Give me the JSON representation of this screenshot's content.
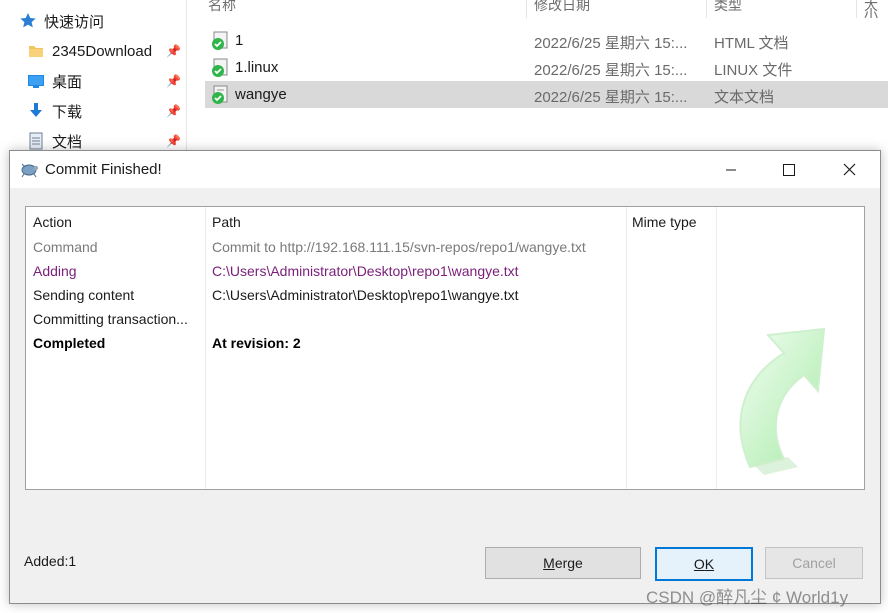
{
  "sidebar": {
    "items": [
      {
        "label": "快速访问",
        "icon": "star-icon",
        "pinned": false
      },
      {
        "label": "2345Download",
        "icon": "folder-icon",
        "pinned": true
      },
      {
        "label": "桌面",
        "icon": "desktop-icon",
        "pinned": true
      },
      {
        "label": "下载",
        "icon": "download-icon",
        "pinned": true
      },
      {
        "label": "文档",
        "icon": "document-icon",
        "pinned": true
      }
    ]
  },
  "file_list": {
    "columns": [
      "名称",
      "修改日期",
      "类型",
      "大小"
    ],
    "rows": [
      {
        "name": "1",
        "date": "2022/6/25 星期六 15:...",
        "type": "HTML 文档",
        "selected": false
      },
      {
        "name": "1.linux",
        "date": "2022/6/25 星期六 15:...",
        "type": "LINUX 文件",
        "selected": false
      },
      {
        "name": "wangye",
        "date": "2022/6/25 星期六 15:...",
        "type": "文本文档",
        "selected": true
      }
    ]
  },
  "dialog": {
    "title": "Commit Finished!",
    "columns": {
      "action": "Action",
      "path": "Path",
      "mime": "Mime type"
    },
    "rows": [
      {
        "action": "Command",
        "path": "Commit to http://192.168.111.15/svn-repos/repo1/wangye.txt",
        "style": "gray"
      },
      {
        "action": "Adding",
        "path": "C:\\Users\\Administrator\\Desktop\\repo1\\wangye.txt",
        "style": "purple"
      },
      {
        "action": "Sending content",
        "path": "C:\\Users\\Administrator\\Desktop\\repo1\\wangye.txt",
        "style": "black"
      },
      {
        "action": "Committing transaction...",
        "path": "",
        "style": "black"
      },
      {
        "action": "Completed",
        "path": "At revision: 2",
        "style": "bold"
      }
    ],
    "status": "Added:1",
    "buttons": {
      "merge_first": "M",
      "merge_rest": "erge",
      "ok_first": "O",
      "ok_rest": "K",
      "cancel": "Cancel"
    }
  },
  "watermark": "CSDN @醉凡尘 ¢ World1y",
  "colors": {
    "selection": "#d9d9d9",
    "accent": "#0078d7",
    "purple_text": "#7a1e7a",
    "arrow_green": "#8fe08f"
  }
}
